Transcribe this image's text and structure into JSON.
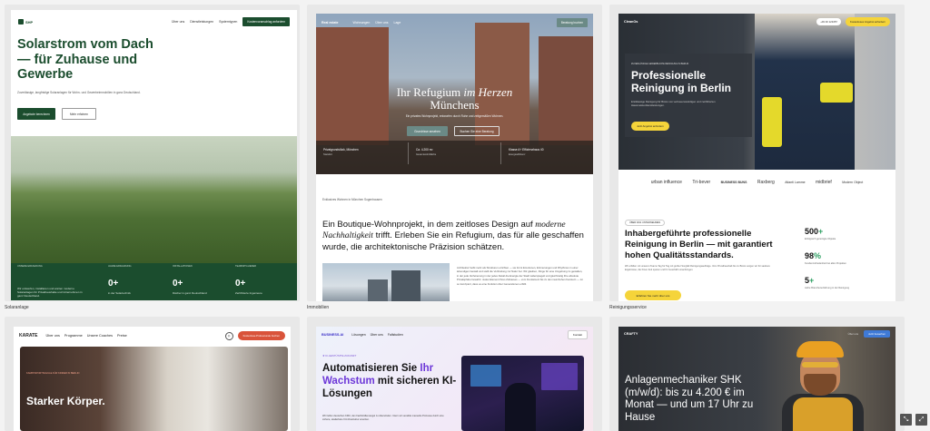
{
  "cards": {
    "solar": {
      "caption": "Solaranlage",
      "logo": "SHP",
      "nav": [
        "Über uns",
        "Dienstleistungen",
        "Systemtypen"
      ],
      "nav_cta": "Kostenvoranschlag anfordern",
      "headline": "Solarstrom vom Dach — für Zuhause und Gewerbe",
      "subline": "Zuverlässige, langfristige Solaranlagen für Wohn- und Gewerbeimmobilien in ganz Deutschland.",
      "button_primary": "Angebote berechnen",
      "button_secondary": "Mehr erfahren",
      "stats": [
        {
          "label": "UNSERE ERFAHRUNG",
          "value": "",
          "desc": "Wir entwerfen, installieren und warten moderne Solaranlagen für Privathaushalte und Unternehmen in ganz Deutschland."
        },
        {
          "label": "JAHRE ERFAHRUNG",
          "value": "0+",
          "desc": "in der Solartechnik"
        },
        {
          "label": "INSTALLATIONEN",
          "value": "0+",
          "desc": "Dächer in ganz Deutschland"
        },
        {
          "label": "TEAMMITGLIEDER",
          "value": "0+",
          "desc": "Zertifizierte Ingenieure"
        }
      ]
    },
    "realestate": {
      "caption": "Immobilien",
      "logo": "Real estate",
      "nav": [
        "Wohnungen",
        "Über uns",
        "Lage"
      ],
      "nav_cta": "Beratung buchen",
      "headline_a": "Ihr Refugium ",
      "headline_em": "im Herzen",
      "headline_b": "Münchens",
      "subline": "Ein privates Wohnprojekt, entworfen durch Ruhe und zeitgemäßen Wohnen.",
      "button_primary": "Grundrisse ansehen",
      "button_secondary": "Buchen Sie eine Beratung",
      "facts": [
        {
          "title": "Privatgrundstück, München",
          "small": "Standort"
        },
        {
          "title": "Ca. 4.200 m²",
          "small": "Gesamtwohnfläche"
        },
        {
          "title": "Klasse A+ Effizienzhaus 40",
          "small": "Energieeffizienz"
        }
      ],
      "eyebrow": "Exklusives Wohnen in München Sogenhausen",
      "h2_a": "Ein Boutique-Wohnprojekt, in dem zeitloses Design auf ",
      "h2_em": "moderne Nachhaltigkeit",
      "h2_b": " trifft. Erleben Sie ein Refugium, das für alle geschaffen wurde, die architektonische Präzision schätzen.",
      "body": "Architektur heißt mehr als Strukturen errichten — sie formt Emotionen, Erinnerungen und Rhythmus in einer lebendigen Gestalt und stellt die Verbindung zur Natur her. Wir glauben, Dinge für eine Umgebung zu gestalten, in der jede Verfeinerung in der jedes Detail die Energie der Stadt widerspiegelt und gleichzeitig Ihre absolute Privatsphäre bewahrt. Jedes Element Ihres Zuhauses — vom Fundament bis zu den raumhohen Fenstern — ist so konzipiert, dass es eine Funktion über Generationen erfüllt."
    },
    "cleaning": {
      "caption": "Reinigungsservice",
      "logo": "CleanOs",
      "phone": "+49 30 123457",
      "nav_cta": "Kostenloses Angebot anfordern",
      "eyebrow": "ZUVERLÄSSIGE GEWERBLICHE REINIGUNG IN BERLIN",
      "headline": "Professionelle Reinigung in Berlin",
      "subline": "Erstklassige Reinigung für Büros von vertrauenswürdigen und zertifizierten Hausmeisterdienstleistungen.",
      "button_primary": "Jetzt Angebot anfordern",
      "logos": [
        "urban influence",
        "Tri-bever",
        "BUSINESS BUNS",
        "Raxberg",
        "Atlanti Lamme",
        "midbrief",
        "Modern Object"
      ],
      "badge": "ÜBER DAS UNTERNEHMEN",
      "h2": "Inhabergeführte professionelle Reinigung in Berlin — mit garantiert hohen Qualitätsstandards.",
      "desc": "Wir erfüllen mit unseren Teams Tag für Tag mit großer Sorgfalt Reinigungsaufträge. Vom Privathaushalt bis zu Büros sorgen wir für saubere Ergebnisse, die Ihnen Zeit sparen und Ihr Geschäft voranbringen.",
      "button_secondary": "Erfahren Sie mehr über uns",
      "stats": [
        {
          "value": "500",
          "suffix": "+",
          "desc": "Erfolgreich gereinigte Objekte"
        },
        {
          "value": "98",
          "suffix": "%",
          "desc": "Kundenzufriedenheit bei allen Projekten"
        },
        {
          "value": "5",
          "suffix": "+",
          "desc": "Jahre Branchenerfahrung in der Reinigung"
        }
      ]
    },
    "karate": {
      "logo": "KARATE",
      "nav": [
        "Über uns",
        "Programme",
        "Unsere Coaches",
        "Preise"
      ],
      "whatsapp": "◎",
      "nav_cta": "Kostenlose Probestunde buchen",
      "eyebrow": "KAMPFSPORTSCHULE FÜR KINDER IN BERLIN",
      "headline": "Starker Körper."
    },
    "business": {
      "logo": "BUSINESS.AI",
      "nav": [
        "Lösungen",
        "Über uns",
        "Fallstudien"
      ],
      "nav_cta": "Kontakt",
      "eyebrow": "★ KI-GESTÜTZTE ZUKUNFT",
      "h1_a": "Automatisieren Sie ",
      "h1_hl": "Ihr Wachstum",
      "h1_b": " mit sicheren KI-Lösungen",
      "sub": "Wir helfen deutschen KMU, den Fachkräftemangel zu überwinden. Intern wir sensible manuelle Prozesse durch eine sichere, skalierbare KI-Infrastruktur ersetzen."
    },
    "crafty": {
      "logo": "CRAFTY",
      "nav_link": "Über uns",
      "nav_cta": "Jetzt bewerben",
      "headline": "Anlagenmechaniker SHK (m/w/d): bis zu 4.200 € im Monat — und um 17 Uhr zu Hause"
    }
  },
  "controls": {
    "zoom_out": "⤡",
    "zoom_in": "⤢"
  }
}
